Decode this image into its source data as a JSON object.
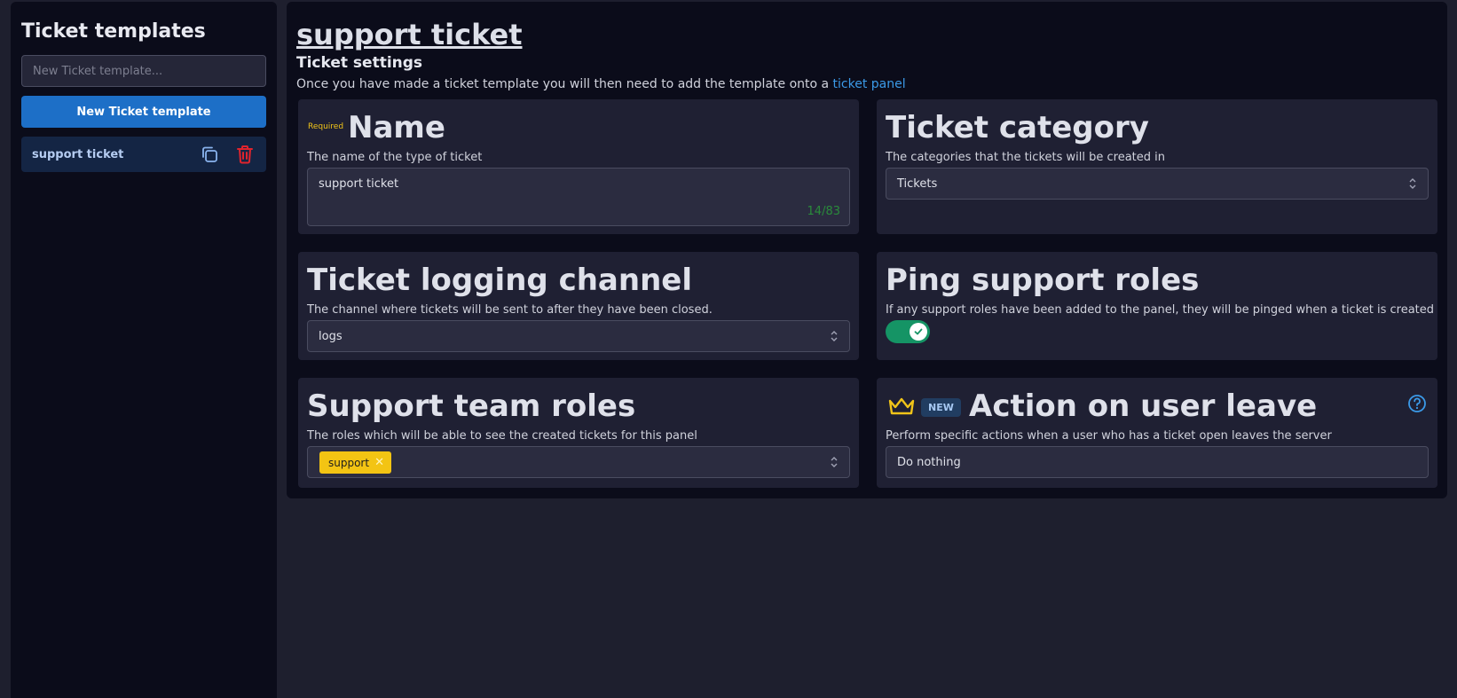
{
  "sidebar": {
    "title": "Ticket templates",
    "input_placeholder": "New Ticket template...",
    "new_button_label": "New Ticket template",
    "items": [
      {
        "label": "support ticket"
      }
    ]
  },
  "main": {
    "page_title": "support ticket",
    "section_title": "Ticket settings",
    "section_desc_prefix": "Once you have made a ticket template you will then need to add the template onto a ",
    "section_desc_link": "ticket panel"
  },
  "cards": {
    "name": {
      "required_label": "Required",
      "title": "Name",
      "desc": "The name of the type of ticket",
      "value": "support ticket",
      "counter": "14/83"
    },
    "category": {
      "title": "Ticket category",
      "desc": "The categories that the tickets will be created in",
      "value": "Tickets"
    },
    "logging": {
      "title": "Ticket logging channel",
      "desc": "The channel where tickets will be sent to after they have been closed.",
      "value": "logs"
    },
    "ping": {
      "title": "Ping support roles",
      "desc": "If any support roles have been added to the panel, they will be pinged when a ticket is created",
      "enabled": true
    },
    "roles": {
      "title": "Support team roles",
      "desc": "The roles which will be able to see the created tickets for this panel",
      "tags": [
        "support"
      ],
      "tag_remove": "✕"
    },
    "leave": {
      "badge": "NEW",
      "title": "Action on user leave",
      "desc": "Perform specific actions when a user who has a ticket open leaves the server",
      "value": "Do nothing"
    }
  },
  "colors": {
    "accent_blue": "#1d6fc7",
    "link_blue": "#3b9ae8",
    "toggle_green": "#159465",
    "tag_yellow": "#f3c413",
    "danger_red": "#e0242d",
    "crown_yellow": "#f0c419"
  }
}
